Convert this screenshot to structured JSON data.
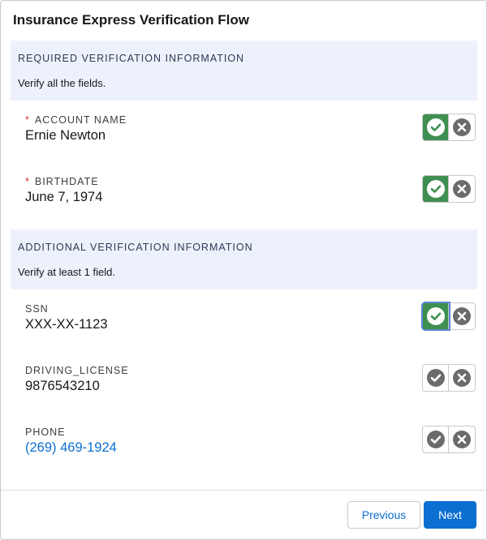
{
  "dialog": {
    "title": "Insurance Express Verification Flow"
  },
  "sections": [
    {
      "title": "REQUIRED VERIFICATION INFORMATION",
      "description": "Verify all the fields."
    },
    {
      "title": "ADDITIONAL VERIFICATION INFORMATION",
      "description": "Verify at least 1 field."
    }
  ],
  "fields": [
    {
      "label": "ACCOUNT NAME",
      "required_mark": "*",
      "value": "Ernie Newton",
      "verified": true
    },
    {
      "label": "BIRTHDATE",
      "required_mark": "*",
      "value": "June 7, 1974",
      "verified": true
    },
    {
      "label": "SSN",
      "value": "XXX-XX-1123",
      "verified": true
    },
    {
      "label": "DRIVING_LICENSE",
      "value": "9876543210",
      "verified": false
    },
    {
      "label": "PHONE",
      "value": "(269) 469-1924",
      "verified": false
    }
  ],
  "icons": {
    "verify": "check-circle-icon",
    "reject": "close-circle-icon"
  },
  "colors": {
    "verified_bg": "#3f8f50",
    "icon_gray": "#6b6b6b",
    "brand_blue": "#0b6fd1",
    "section_bg": "#edf1fb",
    "required": "#c23934"
  },
  "footer": {
    "previous_label": "Previous",
    "next_label": "Next"
  }
}
